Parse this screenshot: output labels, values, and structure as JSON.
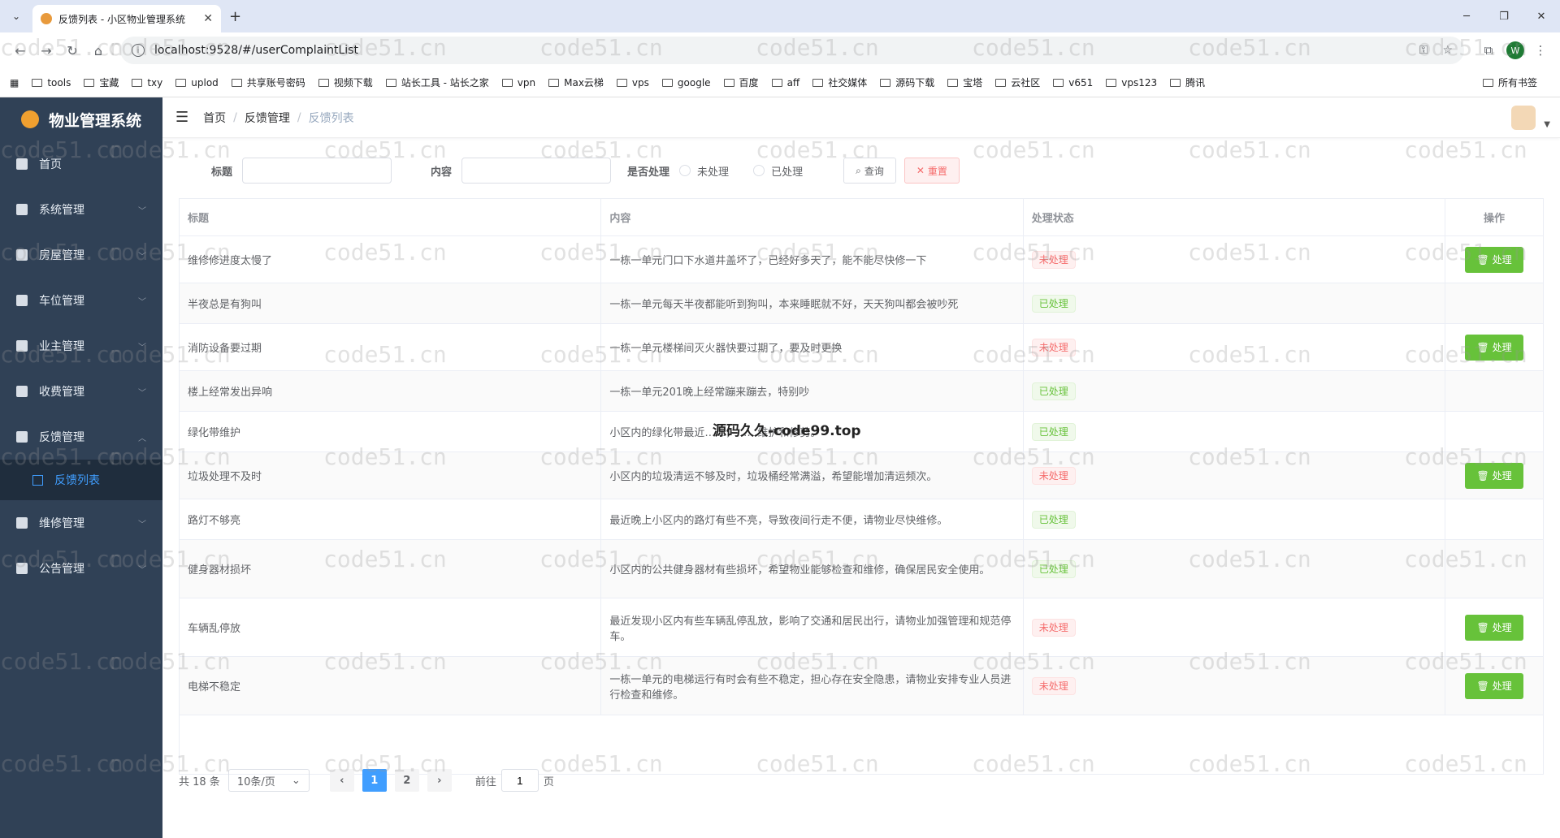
{
  "browser": {
    "tab_title": "反馈列表 - 小区物业管理系统",
    "url": "localhost:9528/#/userComplaintList",
    "profile_initial": "W",
    "bookmarks": [
      "tools",
      "宝藏",
      "txy",
      "uplod",
      "共享账号密码",
      "视频下载",
      "站长工具 - 站长之家",
      "vpn",
      "Max云梯",
      "vps",
      "google",
      "百度",
      "aff",
      "社交媒体",
      "源码下载",
      "宝塔",
      "云社区",
      "v651",
      "vps123",
      "腾讯"
    ],
    "bookmarks_all": "所有书签"
  },
  "sidebar": {
    "app_title": "物业管理系统",
    "items": [
      {
        "label": "首页",
        "icon": "dashboard-icon"
      },
      {
        "label": "系统管理",
        "icon": "grid-icon"
      },
      {
        "label": "房屋管理",
        "icon": "plus-circle-icon"
      },
      {
        "label": "车位管理",
        "icon": "parking-icon"
      },
      {
        "label": "业主管理",
        "icon": "table-icon"
      },
      {
        "label": "收费管理",
        "icon": "tag-icon"
      },
      {
        "label": "反馈管理",
        "icon": "calendar-icon"
      },
      {
        "label": "维修管理",
        "icon": "picture-icon"
      },
      {
        "label": "公告管理",
        "icon": "copy-icon"
      }
    ],
    "sub_item": "反馈列表"
  },
  "breadcrumb": [
    "首页",
    "反馈管理",
    "反馈列表"
  ],
  "filter": {
    "title_label": "标题",
    "content_label": "内容",
    "status_label": "是否处理",
    "radio_unprocessed": "未处理",
    "radio_processed": "已处理",
    "search_btn": "查询",
    "reset_btn": "重置"
  },
  "table": {
    "headers": [
      "标题",
      "内容",
      "处理状态",
      "操作"
    ],
    "action_label": "处理",
    "rows": [
      {
        "title": "维修修进度太慢了",
        "content": "一栋一单元门口下水道井盖坏了，已经好多天了，能不能尽快修一下",
        "status": "未处理",
        "status_type": "pending"
      },
      {
        "title": "半夜总是有狗叫",
        "content": "一栋一单元每天半夜都能听到狗叫，本来睡眠就不好，天天狗叫都会被吵死",
        "status": "已处理",
        "status_type": "done"
      },
      {
        "title": "消防设备要过期",
        "content": "一栋一单元楼梯间灭火器快要过期了，要及时更换",
        "status": "未处理",
        "status_type": "pending"
      },
      {
        "title": "楼上经常发出异响",
        "content": "一栋一单元201晚上经常蹦来蹦去，特别吵",
        "status": "已处理",
        "status_type": "done"
      },
      {
        "title": "绿化带维护",
        "content": "小区内的绿化带最近……，……维护和修剪。",
        "status": "已处理",
        "status_type": "done"
      },
      {
        "title": "垃圾处理不及时",
        "content": "小区内的垃圾清运不够及时，垃圾桶经常满溢，希望能增加清运频次。",
        "status": "未处理",
        "status_type": "pending"
      },
      {
        "title": "路灯不够亮",
        "content": "最近晚上小区内的路灯有些不亮，导致夜间行走不便，请物业尽快维修。",
        "status": "已处理",
        "status_type": "done"
      },
      {
        "title": "健身器材损坏",
        "content": "小区内的公共健身器材有些损坏，希望物业能够检查和维修，确保居民安全使用。",
        "status": "已处理",
        "status_type": "done"
      },
      {
        "title": "车辆乱停放",
        "content": "最近发现小区内有些车辆乱停乱放，影响了交通和居民出行，请物业加强管理和规范停车。",
        "status": "未处理",
        "status_type": "pending"
      },
      {
        "title": "电梯不稳定",
        "content": "一栋一单元的电梯运行有时会有些不稳定，担心存在安全隐患，请物业安排专业人员进行检查和维修。",
        "status": "未处理",
        "status_type": "pending"
      }
    ]
  },
  "pagination": {
    "total": "共 18 条",
    "page_size": "10条/页",
    "pages": [
      "1",
      "2"
    ],
    "current": "1",
    "goto_prefix": "前往",
    "goto_value": "1",
    "goto_suffix": "页"
  },
  "watermark": {
    "repeat_text": "code51.cn",
    "center_text": "源码久久-code99.top"
  }
}
